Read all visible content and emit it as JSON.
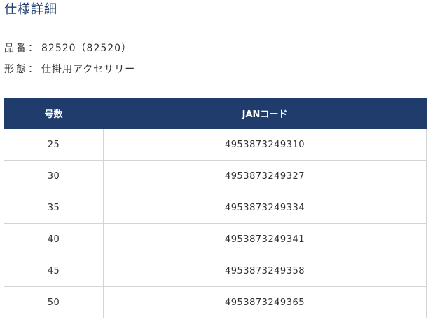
{
  "section": {
    "title": "仕様詳細"
  },
  "specs": {
    "product_number_label": "品番",
    "product_number_value": "82520（82520）",
    "form_label": "形態",
    "form_value": "仕掛用アクセサリー",
    "separator": "："
  },
  "table": {
    "headers": [
      "号数",
      "JANコード"
    ],
    "rows": [
      {
        "size": "25",
        "jan": "4953873249310"
      },
      {
        "size": "30",
        "jan": "4953873249327"
      },
      {
        "size": "35",
        "jan": "4953873249334"
      },
      {
        "size": "40",
        "jan": "4953873249341"
      },
      {
        "size": "45",
        "jan": "4953873249358"
      },
      {
        "size": "50",
        "jan": "4953873249365"
      }
    ]
  }
}
